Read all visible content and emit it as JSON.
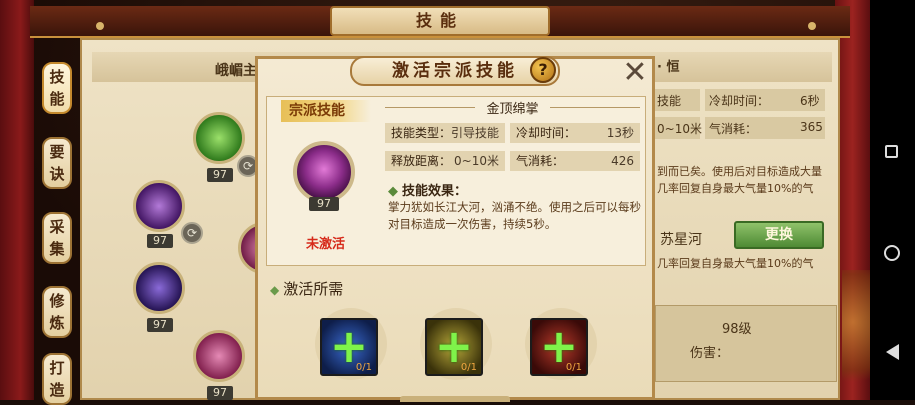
{
  "window": {
    "title": "技能"
  },
  "tabs": [
    {
      "label": "技能",
      "active": true
    },
    {
      "label": "要诀",
      "active": false
    },
    {
      "label": "采集",
      "active": false
    },
    {
      "label": "修炼",
      "active": false
    },
    {
      "label": "打造",
      "active": false
    }
  ],
  "left_panel": {
    "sect_name": "峨嵋主",
    "orbs": [
      {
        "name": "skill-orb-green",
        "level": "97",
        "color": "#4fb33a"
      },
      {
        "name": "skill-orb-purple-1",
        "level": "97",
        "color": "#7b3aa8"
      },
      {
        "name": "skill-orb-purple-2",
        "level": "97",
        "color": "#5a3aa0"
      },
      {
        "name": "skill-orb-pink-1",
        "level": "97",
        "color": "#a0306a"
      },
      {
        "name": "skill-orb-pink-2",
        "level": "97",
        "color": "#c03a82"
      }
    ]
  },
  "right_panel": {
    "header_fragment": "· 恒",
    "skill_type_fragment": "技能",
    "cooldown_label": "冷却时间：",
    "cooldown_value": "6秒",
    "range_fragment": "0~10米",
    "qi_label": "气消耗：",
    "qi_value": "365",
    "desc_line1": "到而已矣。使用后对目标造成大量",
    "desc_line2": "几率回复自身最大气量10%的气",
    "other_skill_name": "苏星河",
    "change_button": "更换",
    "desc_line3": "几率回复自身最大气量10%的气",
    "level_text": "98级",
    "damage_label": "伤害："
  },
  "popup": {
    "title": "激活宗派技能",
    "help": "?",
    "close": "X",
    "sect_skill_label": "宗派技能",
    "skill_level": "97",
    "status": "未激活",
    "skill_name": "金顶绵掌",
    "stats": {
      "type_label": "技能类型：",
      "type_value": "引导技能",
      "cooldown_label": "冷却时间：",
      "cooldown_value": "13秒",
      "range_label": "释放距离：",
      "range_value": "0~10米",
      "qi_label": "气消耗：",
      "qi_value": "426"
    },
    "effect_title": "技能效果：",
    "effect_text": "掌力犹如长江大河，汹涌不绝。使用之后可以每秒对目标造成一次伤害，持续5秒。",
    "requirements_title": "激活所需",
    "requirements": [
      {
        "name": "requirement-item-blue",
        "count": "0/1",
        "color": "#1c3a7a"
      },
      {
        "name": "requirement-item-yellow",
        "count": "0/1",
        "color": "#5a5010"
      },
      {
        "name": "requirement-item-red",
        "count": "0/1",
        "color": "#6a1010"
      }
    ]
  },
  "colors": {
    "accent_gold": "#c9913c",
    "parchment": "#efe3c6",
    "inactive_red": "#d62a1a",
    "plus_green": "#7ff34a"
  }
}
